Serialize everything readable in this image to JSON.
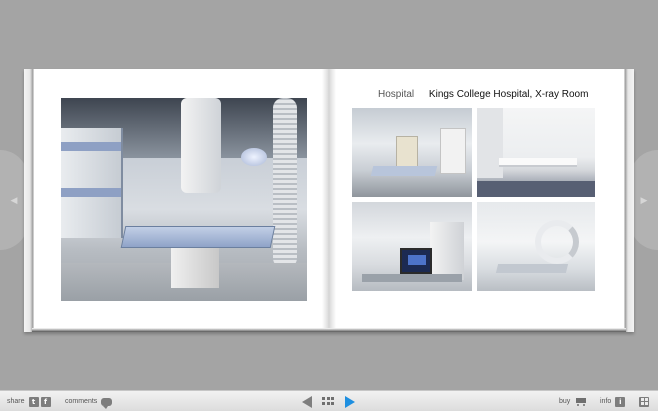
{
  "book": {
    "spread": {
      "category": "Hospital",
      "title": "Kings College Hospital, X-ray Room"
    }
  },
  "toolbar": {
    "share_label": "share",
    "twitter_glyph": "t",
    "facebook_glyph": "f",
    "comments_label": "comments",
    "buy_label": "buy",
    "info_label": "info",
    "info_glyph": "i"
  },
  "side_nav": {
    "left_glyph": "◀",
    "right_glyph": "▶"
  },
  "colors": {
    "background": "#a4a4a4",
    "accent_next": "#1e8fe0",
    "toolbar": "#e6e6e6"
  },
  "icons": [
    "twitter-icon",
    "facebook-icon",
    "comment-bubble-icon",
    "prev-page-icon",
    "thumbnails-grid-icon",
    "next-page-icon",
    "cart-icon",
    "info-icon",
    "fullscreen-grid-icon"
  ]
}
